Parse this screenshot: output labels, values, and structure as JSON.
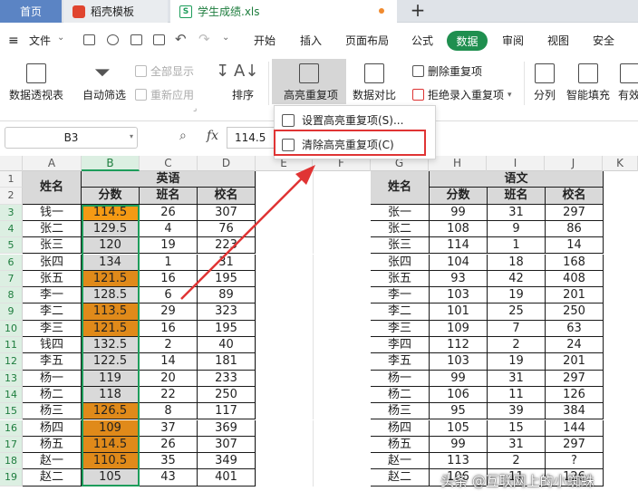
{
  "tabs": {
    "home": "首页",
    "template": "稻壳模板",
    "file": "学生成绩.xls",
    "new_tab": "+"
  },
  "menu": {
    "file": "文件",
    "items": [
      "开始",
      "插入",
      "页面布局",
      "公式",
      "数据",
      "审阅",
      "视图",
      "安全"
    ],
    "active": "数据"
  },
  "ribbon": {
    "pivot": "数据透视表",
    "autofilter": "自动筛选",
    "show_all": "全部显示",
    "reapply": "重新应用",
    "sort": "排序",
    "highlight_dup": "高亮重复项",
    "compare": "数据对比",
    "remove_dup": "删除重复项",
    "reject_dup": "拒绝录入重复项",
    "split": "分列",
    "smart_fill": "智能填充",
    "more": "有效"
  },
  "dropdown": {
    "set_highlight": "设置高亮重复项(S)...",
    "clear_highlight": "清除高亮重复项(C)"
  },
  "formula_bar": {
    "cell_ref": "B3",
    "value": "114.5"
  },
  "columns": [
    "A",
    "B",
    "C",
    "D",
    "E",
    "F",
    "G",
    "H",
    "I",
    "J",
    "K"
  ],
  "rows": [
    "1",
    "2",
    "3",
    "4",
    "5",
    "6",
    "7",
    "8",
    "9",
    "10",
    "11",
    "12",
    "13",
    "14",
    "15",
    "16",
    "17",
    "18",
    "19"
  ],
  "left_table": {
    "name_header": "姓名",
    "group_header": "英语",
    "sub_headers": [
      "分数",
      "班名",
      "校名"
    ],
    "records": [
      {
        "name": "钱一",
        "score": "114.5",
        "class": "26",
        "school": "307",
        "dup": true
      },
      {
        "name": "张二",
        "score": "129.5",
        "class": "4",
        "school": "76",
        "dup": false
      },
      {
        "name": "张三",
        "score": "120",
        "class": "19",
        "school": "223",
        "dup": false
      },
      {
        "name": "张四",
        "score": "134",
        "class": "1",
        "school": "31",
        "dup": false
      },
      {
        "name": "张五",
        "score": "121.5",
        "class": "16",
        "school": "195",
        "dup": true
      },
      {
        "name": "李一",
        "score": "128.5",
        "class": "6",
        "school": "89",
        "dup": false
      },
      {
        "name": "李二",
        "score": "113.5",
        "class": "29",
        "school": "323",
        "dup": true
      },
      {
        "name": "李三",
        "score": "121.5",
        "class": "16",
        "school": "195",
        "dup": true
      },
      {
        "name": "钱四",
        "score": "132.5",
        "class": "2",
        "school": "40",
        "dup": false
      },
      {
        "name": "李五",
        "score": "122.5",
        "class": "14",
        "school": "181",
        "dup": false
      },
      {
        "name": "杨一",
        "score": "119",
        "class": "20",
        "school": "233",
        "dup": false
      },
      {
        "name": "杨二",
        "score": "118",
        "class": "22",
        "school": "250",
        "dup": false
      },
      {
        "name": "杨三",
        "score": "126.5",
        "class": "8",
        "school": "117",
        "dup": true
      },
      {
        "name": "杨四",
        "score": "109",
        "class": "37",
        "school": "369",
        "dup": true
      },
      {
        "name": "杨五",
        "score": "114.5",
        "class": "26",
        "school": "307",
        "dup": true
      },
      {
        "name": "赵一",
        "score": "110.5",
        "class": "35",
        "school": "349",
        "dup": true
      },
      {
        "name": "赵二",
        "score": "105",
        "class": "43",
        "school": "401",
        "dup": false
      }
    ]
  },
  "right_table": {
    "name_header": "姓名",
    "group_header": "语文",
    "sub_headers": [
      "分数",
      "班名",
      "校名"
    ],
    "records": [
      {
        "name": "张一",
        "score": "99",
        "class": "31",
        "school": "297"
      },
      {
        "name": "张二",
        "score": "108",
        "class": "9",
        "school": "86"
      },
      {
        "name": "张三",
        "score": "114",
        "class": "1",
        "school": "14"
      },
      {
        "name": "张四",
        "score": "104",
        "class": "18",
        "school": "168"
      },
      {
        "name": "张五",
        "score": "93",
        "class": "42",
        "school": "408"
      },
      {
        "name": "李一",
        "score": "103",
        "class": "19",
        "school": "201"
      },
      {
        "name": "李二",
        "score": "101",
        "class": "25",
        "school": "250"
      },
      {
        "name": "李三",
        "score": "109",
        "class": "7",
        "school": "63"
      },
      {
        "name": "李四",
        "score": "112",
        "class": "2",
        "school": "24"
      },
      {
        "name": "李五",
        "score": "103",
        "class": "19",
        "school": "201"
      },
      {
        "name": "杨一",
        "score": "99",
        "class": "31",
        "school": "297"
      },
      {
        "name": "杨二",
        "score": "106",
        "class": "11",
        "school": "126"
      },
      {
        "name": "杨三",
        "score": "95",
        "class": "39",
        "school": "384"
      },
      {
        "name": "杨四",
        "score": "105",
        "class": "15",
        "school": "144"
      },
      {
        "name": "杨五",
        "score": "99",
        "class": "31",
        "school": "297"
      },
      {
        "name": "赵一",
        "score": "113",
        "class": "2",
        "school": "?"
      },
      {
        "name": "赵二",
        "score": "106",
        "class": "11",
        "school": "126"
      }
    ]
  },
  "colors": {
    "highlight": "#e08a1a",
    "first_highlight": "#f59a14",
    "normal_score": "#d9d9d9",
    "accent": "#1f8f4f",
    "red": "#e03434"
  },
  "watermark": "头条 @互联网上的小蜘蛛"
}
